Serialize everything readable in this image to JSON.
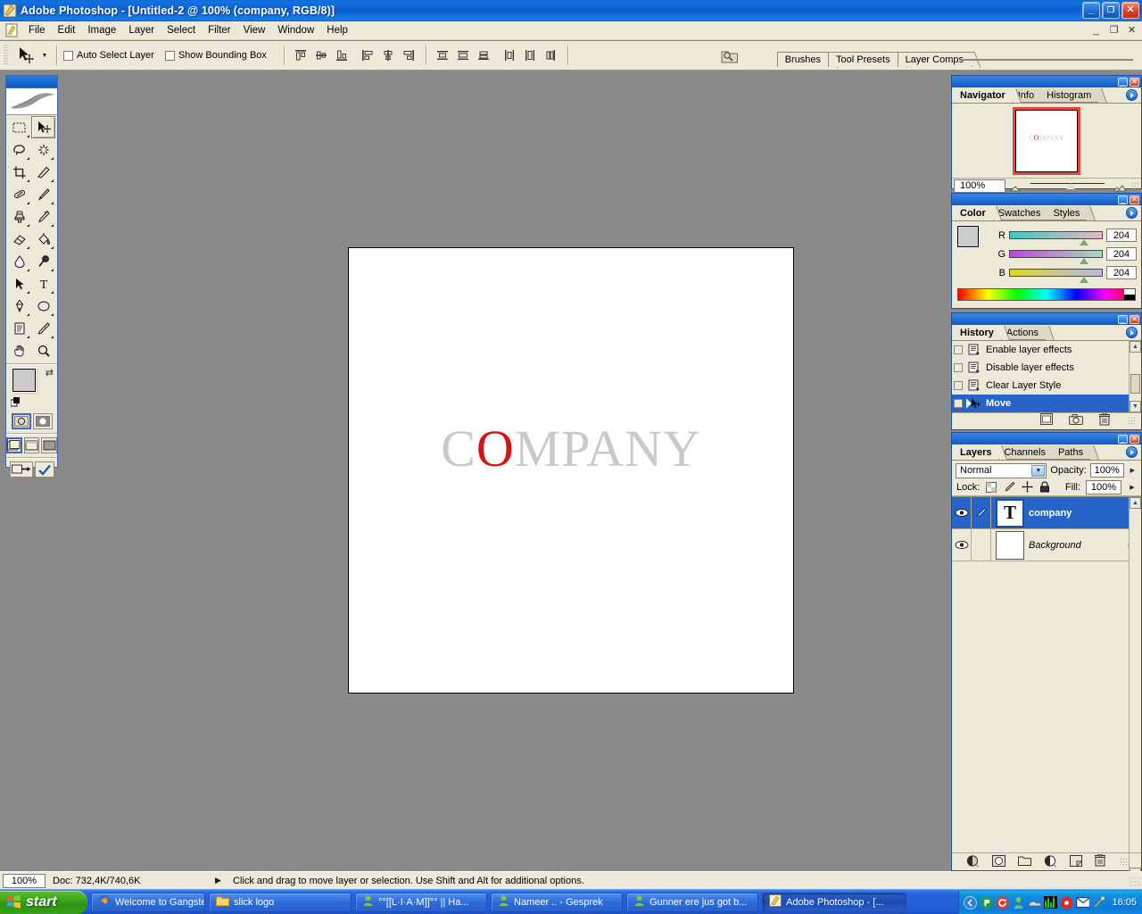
{
  "window": {
    "title": "Adobe Photoshop - [Untitled-2 @ 100% (company, RGB/8)]",
    "minimize": "_",
    "restore": "❐",
    "close": "✕"
  },
  "menu": {
    "items": [
      "File",
      "Edit",
      "Image",
      "Layer",
      "Select",
      "Filter",
      "View",
      "Window",
      "Help"
    ]
  },
  "mdi_controls": {
    "minimize": "_",
    "restore": "❐",
    "close": "✕"
  },
  "options_bar": {
    "tool": "move-tool",
    "auto_select_layer": "Auto Select Layer",
    "show_bounding_box": "Show Bounding Box",
    "align_icons": [
      "align-top-edges",
      "align-vertical-centers",
      "align-bottom-edges",
      "align-left-edges",
      "align-horizontal-centers",
      "align-right-edges"
    ],
    "distribute_icons": [
      "distribute-top-edges",
      "distribute-vertical-centers",
      "distribute-bottom-edges",
      "distribute-left-edges",
      "distribute-horizontal-centers",
      "distribute-right-edges"
    ],
    "palette_well": [
      "Brushes",
      "Tool Presets",
      "Layer Comps"
    ]
  },
  "toolbox": {
    "tools": [
      "rectangular-marquee",
      "move",
      "lasso",
      "magic-wand",
      "crop",
      "slice",
      "healing-brush",
      "brush",
      "clone-stamp",
      "history-brush",
      "eraser",
      "paint-bucket",
      "blur",
      "dodge",
      "path-selection",
      "type",
      "pen",
      "ellipse-shape",
      "notes",
      "eyedropper",
      "hand",
      "zoom"
    ],
    "selected": "move",
    "foreground_color": "#cccccc",
    "background_color": "#e01212",
    "mode_buttons": [
      "standard-mask-mode",
      "quick-mask-mode"
    ],
    "screen_buttons": [
      "standard-screen-mode",
      "full-screen-with-menubar",
      "full-screen-mode"
    ],
    "jump_buttons": [
      "jump-to-imageready",
      "jump-to-other"
    ]
  },
  "document": {
    "logo_part1": "C",
    "logo_o": "O",
    "logo_part2": "MPANY",
    "logo_color_gray": "#c9c9c9",
    "logo_color_red": "#d81212"
  },
  "navigator": {
    "tabs": [
      "Navigator",
      "Info",
      "Histogram"
    ],
    "active_tab": "Navigator",
    "zoom": "100%",
    "thumb_text_pre": "C",
    "thumb_text_o": "O",
    "thumb_text_post": "MPANY"
  },
  "color": {
    "tabs": [
      "Color",
      "Swatches",
      "Styles"
    ],
    "active_tab": "Color",
    "channels": [
      {
        "label": "R",
        "value": "204",
        "pct": 80
      },
      {
        "label": "G",
        "value": "204",
        "pct": 80
      },
      {
        "label": "B",
        "value": "204",
        "pct": 80
      }
    ],
    "foreground": "#cccccc",
    "background": "#e01212"
  },
  "history": {
    "tabs": [
      "History",
      "Actions"
    ],
    "active_tab": "History",
    "items": [
      {
        "label": "Enable layer effects",
        "selected": false
      },
      {
        "label": "Disable layer effects",
        "selected": false
      },
      {
        "label": "Clear Layer Style",
        "selected": false
      },
      {
        "label": "Move",
        "selected": true
      }
    ],
    "footer_icons": [
      "new-document-from-state",
      "create-new-snapshot",
      "delete-state"
    ]
  },
  "layers": {
    "tabs": [
      "Layers",
      "Channels",
      "Paths"
    ],
    "active_tab": "Layers",
    "blend_mode": "Normal",
    "opacity_label": "Opacity:",
    "opacity_value": "100%",
    "lock_label": "Lock:",
    "lock_icons": [
      "lock-transparent-pixels",
      "lock-image-pixels",
      "lock-position",
      "lock-all"
    ],
    "fill_label": "Fill:",
    "fill_value": "100%",
    "rows": [
      {
        "name": "company",
        "thumb": "T",
        "type": "text",
        "selected": true,
        "visible": true,
        "linked": true,
        "locked": false
      },
      {
        "name": "Background",
        "thumb": "",
        "type": "image",
        "selected": false,
        "visible": true,
        "linked": false,
        "locked": true
      }
    ],
    "footer_icons": [
      "layer-style",
      "layer-mask",
      "new-group",
      "new-adjustment-layer",
      "new-layer",
      "delete-layer"
    ]
  },
  "status_bar": {
    "zoom": "100%",
    "doc": "Doc: 732,4K/740,6K",
    "hint": "Click and drag to move layer or selection.  Use Shift and Alt for additional options."
  },
  "taskbar": {
    "start": "start",
    "buttons": [
      {
        "label": "Welcome to Gangster...",
        "icon": "firefox-icon",
        "active": false
      },
      {
        "label": "slick logo",
        "icon": "folder-icon",
        "active": false
      },
      {
        "label": "°°[[L·I·A·M]]°° || Ha...",
        "icon": "msn-contact-icon",
        "active": false
      },
      {
        "label": "Nameer .. - Gesprek",
        "icon": "msn-contact-icon",
        "active": false
      },
      {
        "label": "Gunner ere jus got b...",
        "icon": "msn-contact-icon",
        "active": false
      },
      {
        "label": "Adobe Photoshop - [...",
        "icon": "photoshop-icon",
        "active": true
      }
    ],
    "tray_icons": [
      "show-hidden-icons",
      "media-player-icon",
      "update-icon",
      "messenger-icon",
      "weather-icon",
      "equalizer-icon",
      "antivirus-icon",
      "mail-icon",
      "comet-icon"
    ],
    "clock": "16:05"
  }
}
